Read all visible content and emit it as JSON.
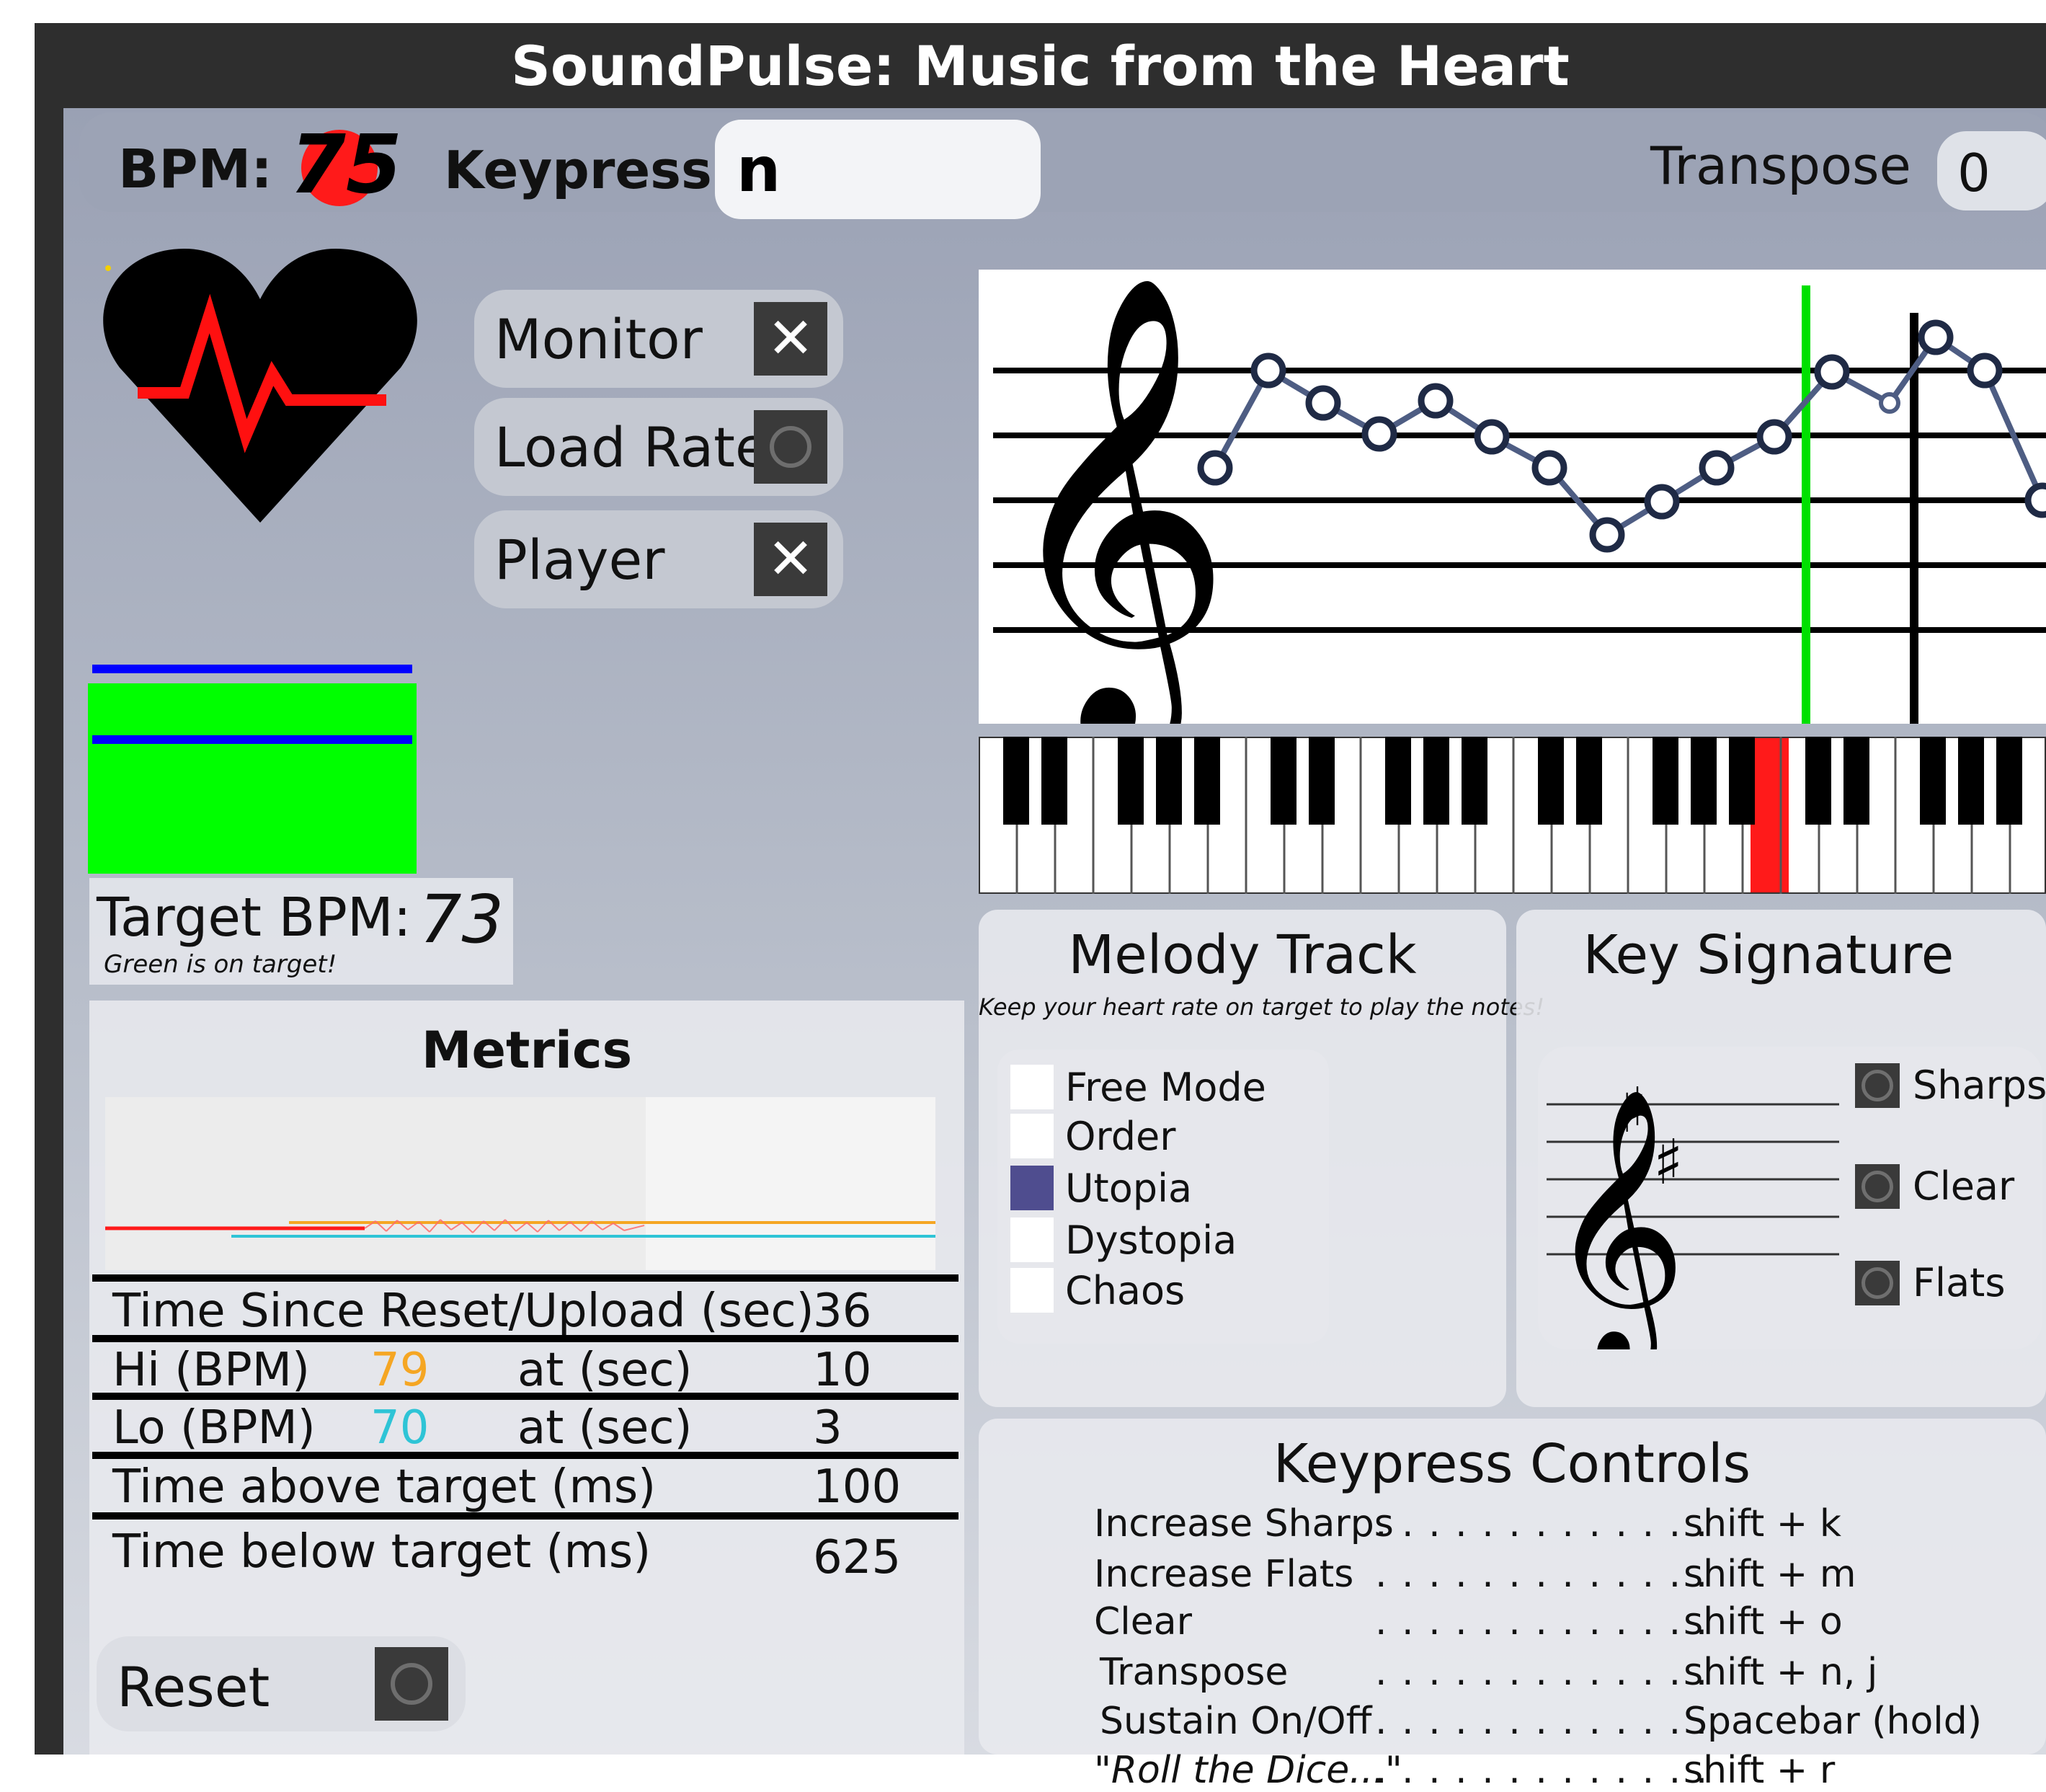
{
  "app": {
    "title": "SoundPulse: Music from the Heart"
  },
  "header": {
    "bpm_label": "BPM:",
    "bpm_value": "75",
    "keypress_label": "Keypress:",
    "keypress_value": "n",
    "transpose_label": "Transpose",
    "transpose_value": "0"
  },
  "toggles": [
    {
      "label": "Monitor",
      "state": "checked"
    },
    {
      "label": "Load Rate",
      "state": "idle"
    },
    {
      "label": "Player",
      "state": "checked"
    }
  ],
  "target": {
    "label": "Target BPM:",
    "value": "73",
    "note": "Green is on target!"
  },
  "metrics": {
    "title": "Metrics",
    "time_since_reset_label": "Time Since Reset/Upload (sec)",
    "time_since_reset_value": "36",
    "hi_label": "Hi (BPM)",
    "hi_value": "79",
    "hi_at_label": "at (sec)",
    "hi_at_value": "10",
    "lo_label": "Lo (BPM)",
    "lo_value": "70",
    "lo_at_label": "at (sec)",
    "lo_at_value": "3",
    "above_label": "Time above target (ms)",
    "above_value": "100",
    "below_label": "Time below target (ms)",
    "below_value": "625"
  },
  "reset": {
    "label": "Reset"
  },
  "melody": {
    "title": "Melody Track",
    "subtitle": "Keep your heart rate on target to play the notes!",
    "modes": [
      "Free Mode",
      "Order",
      "Utopia",
      "Dystopia",
      "Chaos"
    ],
    "selected": "Utopia"
  },
  "key_signature": {
    "title": "Key Signature",
    "sharps_label": "Sharps",
    "clear_label": "Clear",
    "flats_label": "Flats"
  },
  "keypress_controls": {
    "title": "Keypress Controls",
    "dots": ". . . . . . . . . . . . .",
    "rows": [
      {
        "action": "Increase Sharps",
        "key": "shift + k"
      },
      {
        "action": "Increase Flats",
        "key": "shift + m"
      },
      {
        "action": "Clear",
        "key": "shift + o"
      },
      {
        "action": "Transpose",
        "key": "shift + n, j"
      },
      {
        "action": "Sustain On/Off",
        "key": "Spacebar (hold)"
      },
      {
        "action": "\"Roll the Dice...\"",
        "key": "shift + r"
      }
    ]
  },
  "colors": {
    "accent_blue": "#4f4d8f",
    "on_target_green": "#00ff00",
    "bpm_red": "#ff1a1a",
    "hi_orange": "#f5a623",
    "lo_cyan": "#2ec4d6"
  },
  "icons": [
    "heart-pulse-icon",
    "close-icon",
    "treble-clef-icon",
    "sharp-icon"
  ]
}
